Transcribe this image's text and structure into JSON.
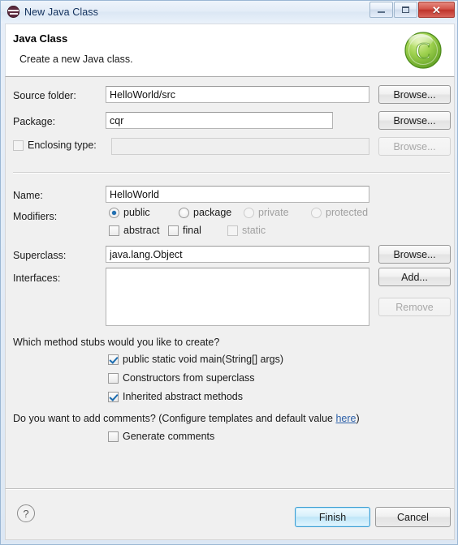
{
  "window": {
    "title": "New Java Class",
    "icon": "eclipse-icon",
    "controls": {
      "minimize": "minimize-button",
      "maximize": "restore-button",
      "close": "close-button",
      "close_glyph": "✕"
    }
  },
  "banner": {
    "title": "Java Class",
    "subtitle": "Create a new Java class.",
    "icon": "java-class-wizard-icon",
    "icon_letter": "C",
    "icon_color": "#7ac943"
  },
  "form": {
    "source_folder": {
      "label": "Source folder:",
      "value": "HelloWorld/src",
      "button": "Browse..."
    },
    "package": {
      "label": "Package:",
      "value": "cqr",
      "placeholder": "",
      "button": "Browse..."
    },
    "enclosing_type": {
      "label": "Enclosing type:",
      "checked": false,
      "value": "",
      "button": "Browse...",
      "enabled": false
    },
    "name": {
      "label": "Name:",
      "value": "HelloWorld"
    },
    "modifiers": {
      "label": "Modifiers:",
      "radios": [
        {
          "label": "public",
          "selected": true,
          "enabled": true
        },
        {
          "label": "package",
          "selected": false,
          "enabled": true
        },
        {
          "label": "private",
          "selected": false,
          "enabled": false
        },
        {
          "label": "protected",
          "selected": false,
          "enabled": false
        }
      ],
      "checks": [
        {
          "label": "abstract",
          "checked": false,
          "enabled": true
        },
        {
          "label": "final",
          "checked": false,
          "enabled": true
        },
        {
          "label": "static",
          "checked": false,
          "enabled": false
        }
      ]
    },
    "superclass": {
      "label": "Superclass:",
      "value": "java.lang.Object",
      "button": "Browse..."
    },
    "interfaces": {
      "label": "Interfaces:",
      "items": [],
      "add_button": "Add...",
      "remove_button": "Remove",
      "remove_enabled": false
    }
  },
  "stubs": {
    "question": "Which method stubs would you like to create?",
    "options": [
      {
        "label": "public static void main(String[] args)",
        "checked": true
      },
      {
        "label": "Constructors from superclass",
        "checked": false
      },
      {
        "label": "Inherited abstract methods",
        "checked": true
      }
    ]
  },
  "comments": {
    "question_prefix": "Do you want to add comments? (Configure templates and default value ",
    "link": "here",
    "question_suffix": ")",
    "option": {
      "label": "Generate comments",
      "checked": false
    }
  },
  "footer": {
    "help": "?",
    "finish": "Finish",
    "cancel": "Cancel"
  }
}
